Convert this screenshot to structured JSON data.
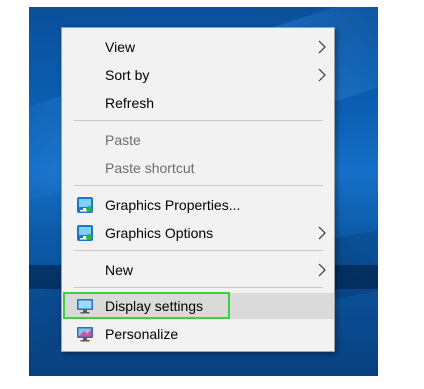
{
  "context_menu": {
    "items": [
      {
        "label": "View",
        "has_submenu": true,
        "disabled": false
      },
      {
        "label": "Sort by",
        "has_submenu": true,
        "disabled": false
      },
      {
        "label": "Refresh",
        "has_submenu": false,
        "disabled": false
      },
      {
        "label": "Paste",
        "has_submenu": false,
        "disabled": true
      },
      {
        "label": "Paste shortcut",
        "has_submenu": false,
        "disabled": true
      },
      {
        "label": "Graphics Properties...",
        "has_submenu": false,
        "disabled": false,
        "icon": "intel-graphics-icon"
      },
      {
        "label": "Graphics Options",
        "has_submenu": true,
        "disabled": false,
        "icon": "intel-graphics-icon"
      },
      {
        "label": "New",
        "has_submenu": true,
        "disabled": false
      },
      {
        "label": "Display settings",
        "has_submenu": false,
        "disabled": false,
        "icon": "display-monitor-icon",
        "highlighted": true
      },
      {
        "label": "Personalize",
        "has_submenu": false,
        "disabled": false,
        "icon": "personalize-monitor-icon"
      }
    ]
  },
  "colors": {
    "menu_background": "#f2f2f2",
    "highlight": "#dadada",
    "focus_outline": "#3dd13d",
    "disabled_text": "#6d6d6d",
    "desktop_accent": "#0b5fb3"
  }
}
